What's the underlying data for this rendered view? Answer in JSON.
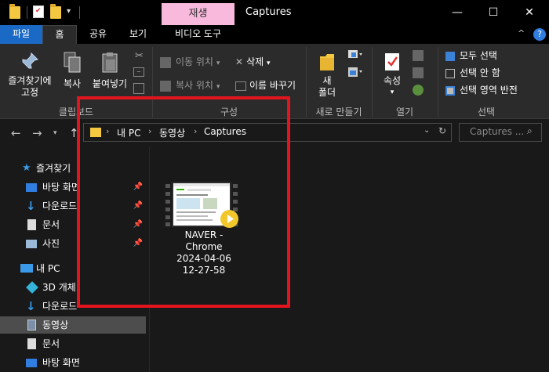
{
  "window": {
    "title": "Captures",
    "context_tab": "재생",
    "context_subtab": "비디오 도구"
  },
  "ribbon_tabs": [
    {
      "label": "파일"
    },
    {
      "label": "홈"
    },
    {
      "label": "공유"
    },
    {
      "label": "보기"
    }
  ],
  "ribbon": {
    "clipboard": {
      "pin_label_1": "즐겨찾기에",
      "pin_label_2": "고정",
      "copy_label": "복사",
      "paste_label": "붙여넣기",
      "group_label": "클립보드"
    },
    "organize": {
      "move_label": "이동 위치",
      "copy_to_label": "복사 위치",
      "delete_label": "삭제",
      "rename_label": "이름 바꾸기",
      "group_label": "구성"
    },
    "new": {
      "new_folder_1": "새",
      "new_folder_2": "폴더",
      "group_label": "새로 만들기"
    },
    "open": {
      "properties_label": "속성",
      "group_label": "열기"
    },
    "select": {
      "select_all": "모두 선택",
      "select_none": "선택 안 함",
      "invert": "선택 영역 반전",
      "group_label": "선택"
    }
  },
  "address": {
    "crumbs": [
      "내 PC",
      "동영상",
      "Captures"
    ],
    "search_placeholder": "Captures ..."
  },
  "nav": {
    "quick_access": "즐겨찾기",
    "quick_items": [
      {
        "label": "바탕 화면"
      },
      {
        "label": "다운로드"
      },
      {
        "label": "문서"
      },
      {
        "label": "사진"
      }
    ],
    "this_pc": "내 PC",
    "pc_items": [
      {
        "label": "3D 개체"
      },
      {
        "label": "다운로드"
      },
      {
        "label": "동영상"
      },
      {
        "label": "문서"
      },
      {
        "label": "바탕 화면"
      }
    ]
  },
  "files": [
    {
      "name_lines": [
        "NAVER -",
        "Chrome",
        "2024-04-06",
        "12-27-58"
      ]
    }
  ],
  "colors": {
    "accent": "#1a69c4",
    "context_tab": "#f9b9dc",
    "highlight": "#e4141e",
    "folder": "#f5c842"
  }
}
